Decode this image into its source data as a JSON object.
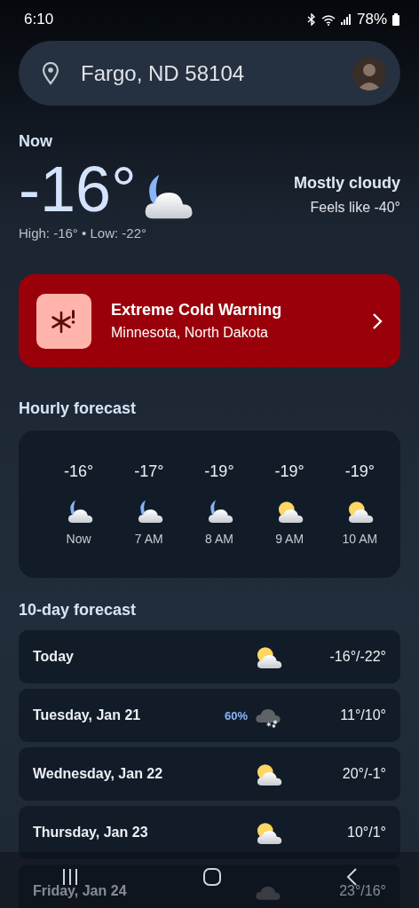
{
  "status_bar": {
    "time": "6:10",
    "battery": "78%"
  },
  "location_bar": {
    "location": "Fargo, ND 58104"
  },
  "now": {
    "label": "Now",
    "temperature": "-16°",
    "condition": "Mostly cloudy",
    "feels_like": "Feels like -40°",
    "high_low": "High: -16° • Low: -22°",
    "kind": "night-cloudy"
  },
  "alert": {
    "title": "Extreme Cold Warning",
    "areas": "Minnesota, North Dakota"
  },
  "hourly": {
    "title": "Hourly forecast",
    "items": [
      {
        "temp": "-16°",
        "time": "Now",
        "kind": "night-cloudy"
      },
      {
        "temp": "-17°",
        "time": "7 AM",
        "kind": "night-cloudy"
      },
      {
        "temp": "-19°",
        "time": "8 AM",
        "kind": "night-cloudy"
      },
      {
        "temp": "-19°",
        "time": "9 AM",
        "kind": "sun-cloudy"
      },
      {
        "temp": "-19°",
        "time": "10 AM",
        "kind": "sun-cloudy"
      }
    ]
  },
  "daily": {
    "title": "10-day forecast",
    "items": [
      {
        "day": "Today",
        "kind": "sun-cloudy",
        "temps": "-16°/-22°"
      },
      {
        "day": "Tuesday, Jan 21",
        "precip": "60%",
        "kind": "snow",
        "temps": "11°/10°"
      },
      {
        "day": "Wednesday, Jan 22",
        "kind": "sun-cloudy",
        "temps": "20°/-1°"
      },
      {
        "day": "Thursday, Jan 23",
        "kind": "sun-cloudy",
        "temps": "10°/1°"
      },
      {
        "day": "Friday, Jan 24",
        "kind": "cloudy",
        "temps": "23°/16°"
      }
    ]
  }
}
